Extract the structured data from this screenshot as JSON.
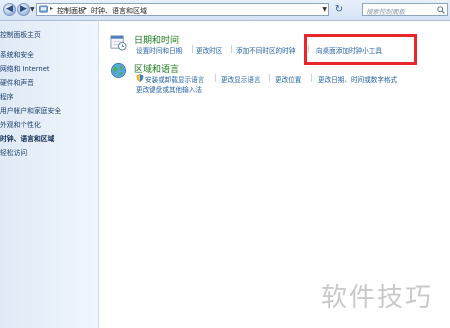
{
  "address_bar": {
    "breadcrumbs": [
      "控制面板",
      "时钟、语言和区域"
    ],
    "search_placeholder": "搜索控制面板"
  },
  "sidebar": {
    "items": [
      {
        "label": "控制面板主页",
        "current": false
      },
      {
        "label": "系统和安全",
        "current": false
      },
      {
        "label": "网络和 Internet",
        "current": false
      },
      {
        "label": "硬件和声音",
        "current": false
      },
      {
        "label": "程序",
        "current": false
      },
      {
        "label": "用户帐户和家庭安全",
        "current": false
      },
      {
        "label": "外观和个性化",
        "current": false
      },
      {
        "label": "时钟、语言和区域",
        "current": true
      },
      {
        "label": "轻松访问",
        "current": false
      }
    ]
  },
  "categories": [
    {
      "title": "日期和时间",
      "icon": "calendar-clock-icon",
      "links": [
        "设置时间和日期",
        "更改时区",
        "添加不同时区的时钟",
        "向桌面添加时钟小工具"
      ]
    },
    {
      "title": "区域和语言",
      "icon": "globe-icon",
      "links_row1": [
        "安装或卸载显示语言",
        "更改显示语言",
        "更改位置",
        "更改日期、时间或数字格式"
      ],
      "links_row2": [
        "更改键盘或其他输入法"
      ]
    }
  ],
  "highlight_color": "#e8262b",
  "watermark": "软件技巧"
}
